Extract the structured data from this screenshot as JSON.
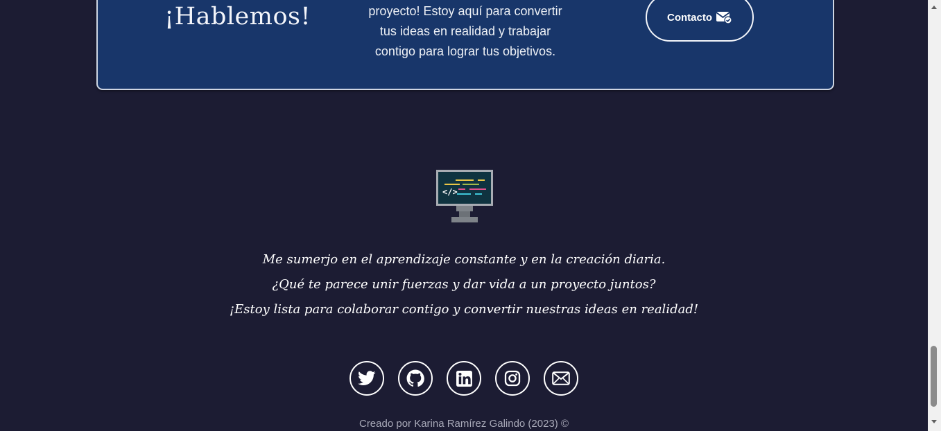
{
  "cta": {
    "title": "¡Hablemos!",
    "text_lines": [
      "proyecto! Estoy aquí para convertir",
      "tus ideas en realidad y trabajar",
      "contigo para lograr tus objetivos."
    ],
    "button_label": "Contacto",
    "button_icon": "envelope-check-icon"
  },
  "footer": {
    "image_icon": "code-monitor-icon",
    "quote_lines": [
      "Me sumerjo en el aprendizaje constante y en la creación diaria.",
      "¿Qué te parece unir fuerzas y dar vida a un proyecto juntos?",
      "¡Estoy lista para colaborar contigo y convertir nuestras ideas en realidad!"
    ],
    "socials": [
      {
        "icon": "twitter-icon"
      },
      {
        "icon": "github-icon"
      },
      {
        "icon": "linkedin-icon"
      },
      {
        "icon": "instagram-icon"
      },
      {
        "icon": "mail-icon"
      }
    ],
    "credits": "Creado por Karina Ramírez Galindo (2023) ©"
  },
  "colors": {
    "page_background": "#1c1c33",
    "card_background": "#18366a",
    "text": "#ffffff",
    "credits_text": "#a8a9b8"
  }
}
